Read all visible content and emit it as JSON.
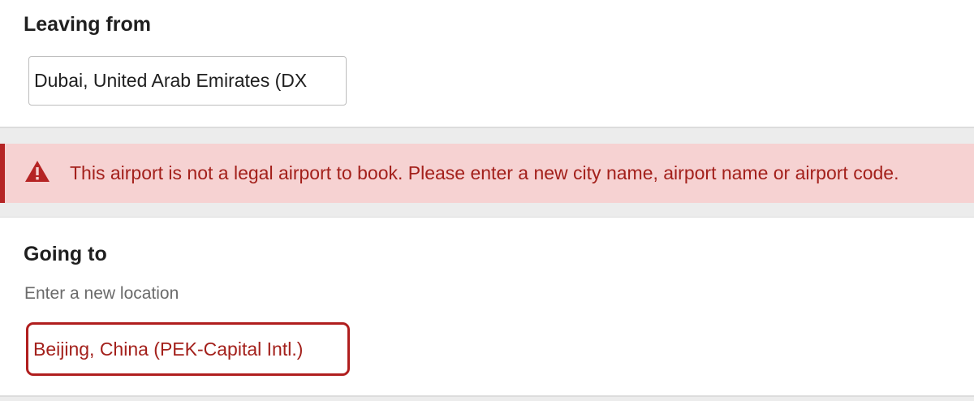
{
  "leaving": {
    "title": "Leaving from",
    "value": "Dubai, United Arab Emirates (DX"
  },
  "alert": {
    "icon": "warning-triangle-icon",
    "message": "This airport is not a legal airport to book. Please enter a new city name, airport name or airport code."
  },
  "going": {
    "title": "Going to",
    "hint": "Enter a new location",
    "value": "Beijing, China (PEK-Capital Intl.)"
  },
  "colors": {
    "error": "#a3201b",
    "error_border": "#b01e1e",
    "alert_background": "#f6d2d2",
    "page_background": "#ececec"
  }
}
